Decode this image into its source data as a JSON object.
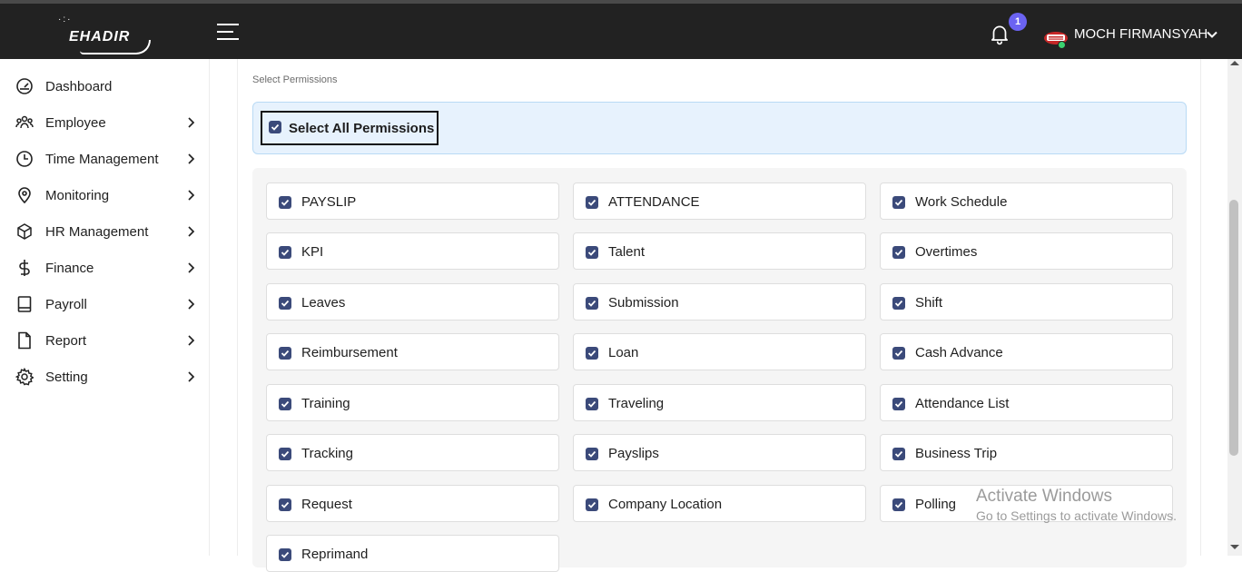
{
  "header": {
    "logo_text": "EHADIR",
    "notification_count": "1",
    "username": "MOCH FIRMANSYAH"
  },
  "sidebar": {
    "items": [
      {
        "label": "Dashboard",
        "icon": "gauge-icon",
        "has_submenu": false
      },
      {
        "label": "Employee",
        "icon": "users-icon",
        "has_submenu": true
      },
      {
        "label": "Time Management",
        "icon": "clock-icon",
        "has_submenu": true
      },
      {
        "label": "Monitoring",
        "icon": "map-pin-icon",
        "has_submenu": true
      },
      {
        "label": "HR Management",
        "icon": "box-icon",
        "has_submenu": true
      },
      {
        "label": "Finance",
        "icon": "dollar-icon",
        "has_submenu": true
      },
      {
        "label": "Payroll",
        "icon": "book-icon",
        "has_submenu": true
      },
      {
        "label": "Report",
        "icon": "file-icon",
        "has_submenu": true
      },
      {
        "label": "Setting",
        "icon": "gear-icon",
        "has_submenu": true
      }
    ]
  },
  "permissions": {
    "section_label": "Select Permissions",
    "select_all_label": "Select All Permissions",
    "select_all_checked": true,
    "items": [
      {
        "label": "PAYSLIP",
        "checked": true
      },
      {
        "label": "ATTENDANCE",
        "checked": true
      },
      {
        "label": "Work Schedule",
        "checked": true
      },
      {
        "label": "KPI",
        "checked": true
      },
      {
        "label": "Talent",
        "checked": true
      },
      {
        "label": "Overtimes",
        "checked": true
      },
      {
        "label": "Leaves",
        "checked": true
      },
      {
        "label": "Submission",
        "checked": true
      },
      {
        "label": "Shift",
        "checked": true
      },
      {
        "label": "Reimbursement",
        "checked": true
      },
      {
        "label": "Loan",
        "checked": true
      },
      {
        "label": "Cash Advance",
        "checked": true
      },
      {
        "label": "Training",
        "checked": true
      },
      {
        "label": "Traveling",
        "checked": true
      },
      {
        "label": "Attendance List",
        "checked": true
      },
      {
        "label": "Tracking",
        "checked": true
      },
      {
        "label": "Payslips",
        "checked": true
      },
      {
        "label": "Business Trip",
        "checked": true
      },
      {
        "label": "Request",
        "checked": true
      },
      {
        "label": "Company Location",
        "checked": true
      },
      {
        "label": "Polling",
        "checked": true
      },
      {
        "label": "Reprimand",
        "checked": true
      }
    ]
  },
  "watermark": {
    "line1": "Activate Windows",
    "line2": "Go to Settings to activate Windows."
  },
  "colors": {
    "topbar": "#222222",
    "checkbox": "#3b4a7a",
    "badge": "#6b63f2",
    "select_all_bg": "#e7f2fd"
  }
}
